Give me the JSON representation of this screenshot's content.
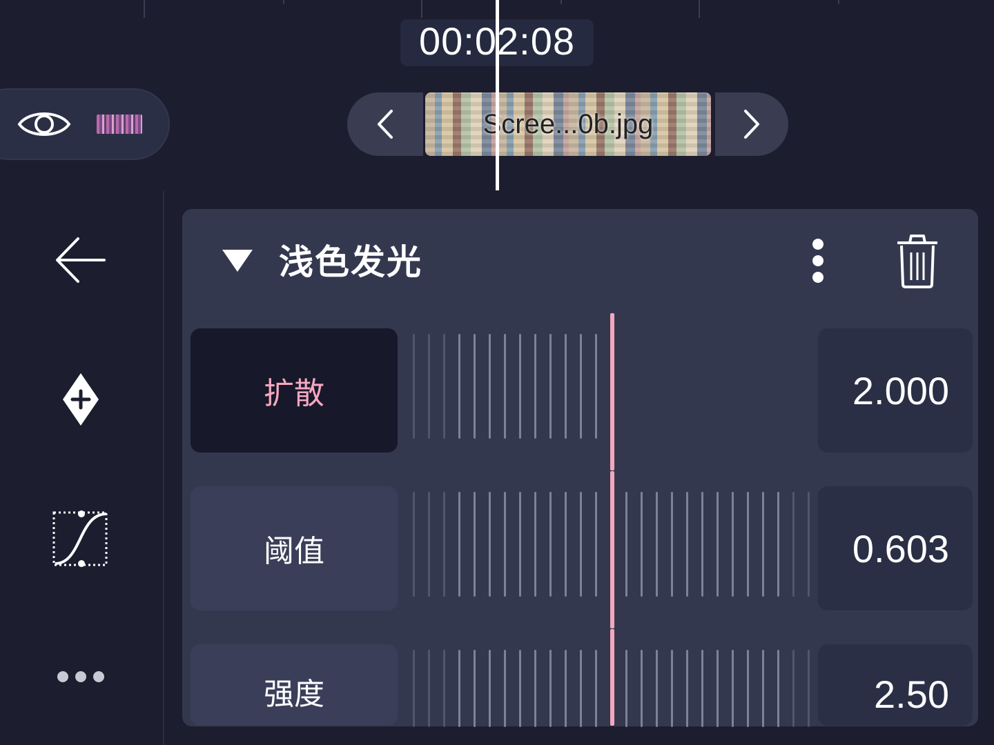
{
  "timeline": {
    "current_time": "00:02:08",
    "clip_name": "Scree...0b.jpg"
  },
  "rail": {
    "back_icon": "arrow-left-icon",
    "keyframe_icon": "keyframe-add-icon",
    "curve_icon": "bezier-curve-icon",
    "more_icon": "ellipsis-icon"
  },
  "effect": {
    "title": "浅色发光",
    "params": [
      {
        "label": "扩散",
        "value": "2.000",
        "active": true
      },
      {
        "label": "阈值",
        "value": "0.603",
        "active": false
      },
      {
        "label": "强度",
        "value": "2.50",
        "active": false
      }
    ]
  },
  "colors": {
    "background": "#1c1d2e",
    "panel": "#34384f",
    "accent": "#f3a7bd",
    "playhead": "#ffffff"
  }
}
